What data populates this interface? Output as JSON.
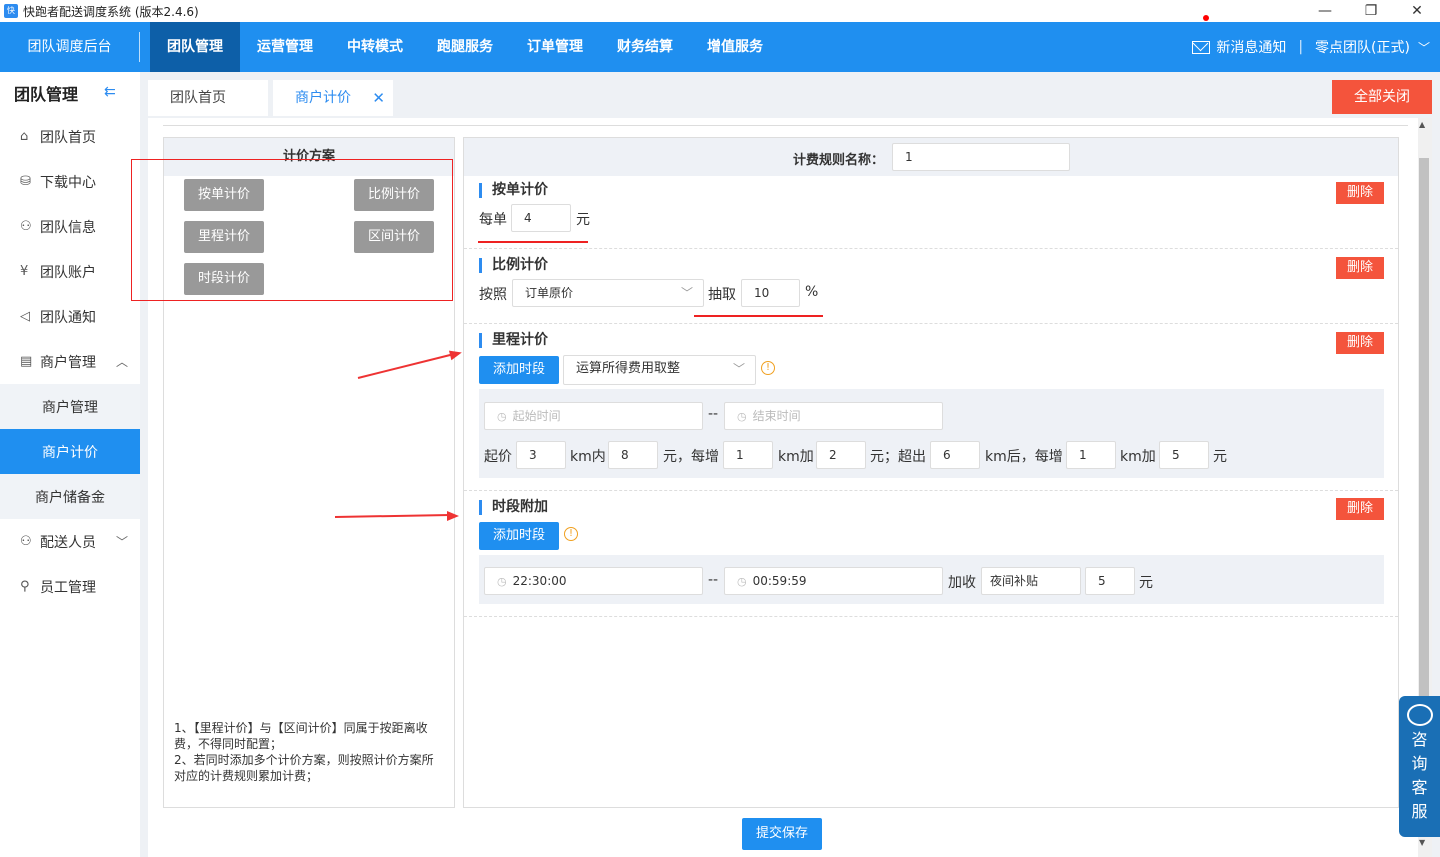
{
  "window": {
    "title": "快跑者配送调度系统 (版本2.4.6)",
    "min": "—",
    "max": "❐",
    "close": "✕"
  },
  "topnav": {
    "brand": "团队调度后台",
    "items": [
      "团队管理",
      "运营管理",
      "中转模式",
      "跑腿服务",
      "订单管理",
      "财务结算",
      "增值服务"
    ],
    "notify": "新消息通知",
    "team": "零点团队(正式)",
    "team_arrow": "﹀"
  },
  "sidebar": {
    "title": "团队管理",
    "collapse_icon": "⇇",
    "items": [
      {
        "label": "团队首页",
        "icon": "⌂"
      },
      {
        "label": "下载中心",
        "icon": "⛁"
      },
      {
        "label": "团队信息",
        "icon": "⚇"
      },
      {
        "label": "团队账户",
        "icon": "¥"
      },
      {
        "label": "团队通知",
        "icon": "◁"
      },
      {
        "label": "商户管理",
        "icon": "▤",
        "arrow": "︿"
      }
    ],
    "sub": [
      "商户管理",
      "商户计价",
      "商户储备金"
    ],
    "items2": [
      {
        "label": "配送人员",
        "icon": "⚇",
        "arrow": "﹀"
      },
      {
        "label": "员工管理",
        "icon": "⚲"
      }
    ]
  },
  "tabs": [
    {
      "label": "团队首页"
    },
    {
      "label": "商户计价",
      "close": "✕"
    }
  ],
  "close_all": "全部关闭",
  "left_panel": {
    "title": "计价方案",
    "buttons": [
      "按单计价",
      "比例计价",
      "里程计价",
      "区间计价",
      "时段计价"
    ],
    "note1": "1、【里程计价】与【区间计价】同属于按距离收费，不得同时配置；",
    "note2": "2、若同时添加多个计价方案，则按照计价方案所对应的计费规则累加计费；"
  },
  "right_panel": {
    "rule_name_label": "计费规则名称：",
    "rule_name_value": "1",
    "delete_label": "删除",
    "per_order": {
      "title": "按单计价",
      "prefix": "每单",
      "value": "4",
      "unit": "元"
    },
    "ratio": {
      "title": "比例计价",
      "by": "按照",
      "select": "订单原价",
      "take": "抽取",
      "value": "10",
      "unit": "%"
    },
    "mileage": {
      "title": "里程计价",
      "add_btn": "添加时段",
      "select": "运算所得费用取整",
      "start_ph": "起始时间",
      "end_ph": "结束时间",
      "sep": "--",
      "l1": "起价",
      "v1": "3",
      "l2": "km内",
      "v2": "8",
      "l3": "元，每增",
      "v3": "1",
      "l4": "km加",
      "v4": "2",
      "l5": "元；超出",
      "v5": "6",
      "l6": "km后，每增",
      "v6": "1",
      "l7": "km加",
      "v7": "5",
      "l8": "元"
    },
    "period": {
      "title": "时段附加",
      "add_btn": "添加时段",
      "start": "22:30:00",
      "end": "00:59:59",
      "sep": "--",
      "charge": "加收",
      "name": "夜间补贴",
      "value": "5",
      "unit": "元"
    },
    "warn_icon": "!",
    "submit": "提交保存"
  },
  "kefu": {
    "chars": [
      "咨",
      "询",
      "客",
      "服"
    ]
  }
}
